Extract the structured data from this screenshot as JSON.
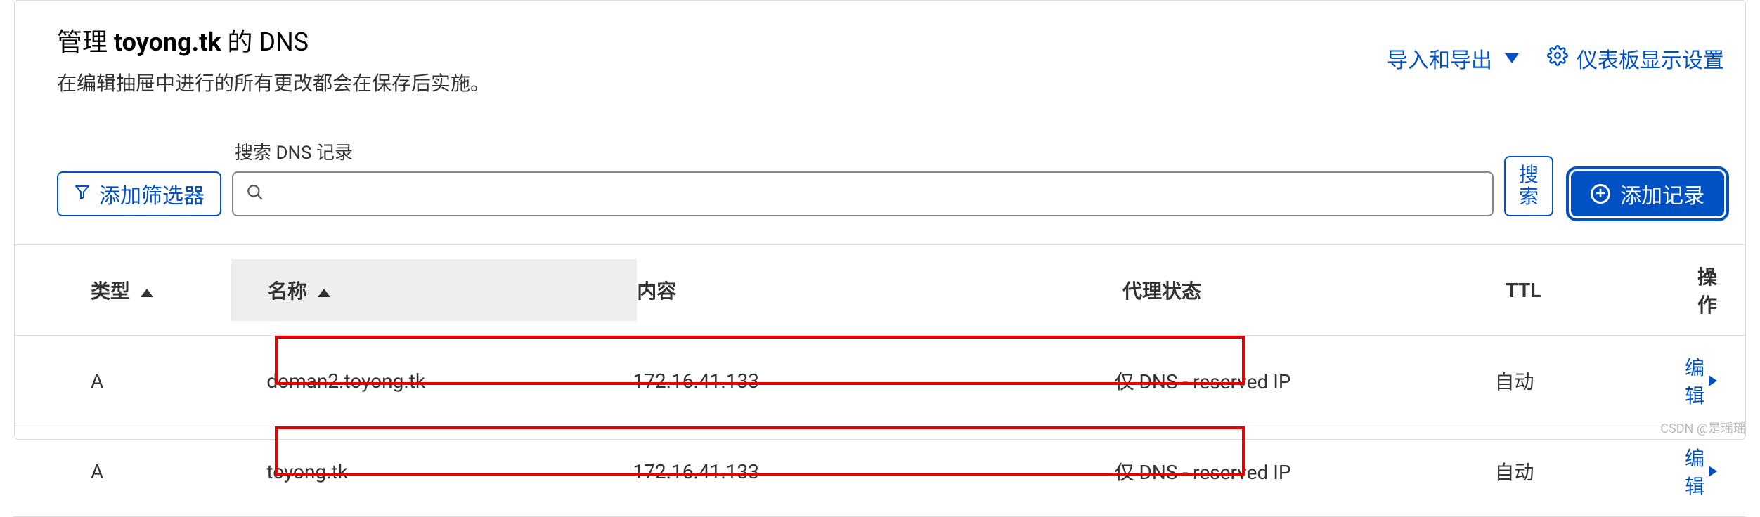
{
  "header": {
    "title_prefix": "管理 ",
    "title_domain": "toyong.tk",
    "title_suffix": " 的 DNS",
    "subtitle": "在编辑抽屉中进行的所有更改都会在保存后实施。",
    "import_export": "导入和导出",
    "dashboard_settings": "仪表板显示设置"
  },
  "filters": {
    "add_filter": "添加筛选器",
    "search_label": "搜索 DNS 记录",
    "search_value": "",
    "search_button": "搜索",
    "add_record": "添加记录"
  },
  "table": {
    "columns": {
      "type": "类型",
      "name": "名称",
      "content": "内容",
      "proxy": "代理状态",
      "ttl": "TTL",
      "actions": "操作"
    },
    "rows": [
      {
        "type": "A",
        "name": "doman2.toyong.tk",
        "content": "172.16.41.133",
        "proxy": "仅 DNS - reserved IP",
        "ttl": "自动",
        "edit": "编辑"
      },
      {
        "type": "A",
        "name": "toyong.tk",
        "content": "172.16.41.133",
        "proxy": "仅 DNS - reserved IP",
        "ttl": "自动",
        "edit": "编辑"
      }
    ]
  },
  "watermark": "CSDN @是瑶瑶"
}
